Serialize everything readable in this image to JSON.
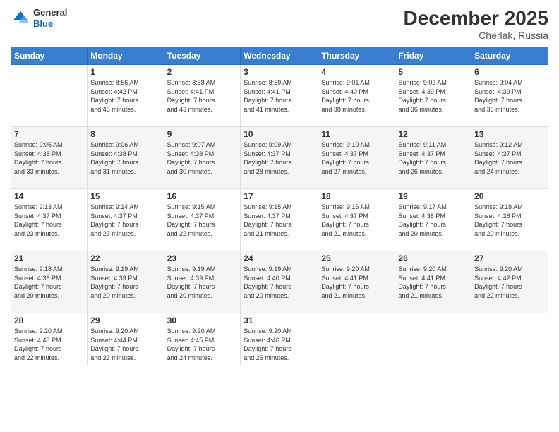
{
  "header": {
    "logo": {
      "general": "General",
      "blue": "Blue"
    },
    "title": "December 2025",
    "location": "Cherlak, Russia"
  },
  "days_of_week": [
    "Sunday",
    "Monday",
    "Tuesday",
    "Wednesday",
    "Thursday",
    "Friday",
    "Saturday"
  ],
  "weeks": [
    [
      {
        "day": "",
        "info": ""
      },
      {
        "day": "1",
        "info": "Sunrise: 8:56 AM\nSunset: 4:42 PM\nDaylight: 7 hours\nand 45 minutes."
      },
      {
        "day": "2",
        "info": "Sunrise: 8:58 AM\nSunset: 4:41 PM\nDaylight: 7 hours\nand 43 minutes."
      },
      {
        "day": "3",
        "info": "Sunrise: 8:59 AM\nSunset: 4:41 PM\nDaylight: 7 hours\nand 41 minutes."
      },
      {
        "day": "4",
        "info": "Sunrise: 9:01 AM\nSunset: 4:40 PM\nDaylight: 7 hours\nand 38 minutes."
      },
      {
        "day": "5",
        "info": "Sunrise: 9:02 AM\nSunset: 4:39 PM\nDaylight: 7 hours\nand 36 minutes."
      },
      {
        "day": "6",
        "info": "Sunrise: 9:04 AM\nSunset: 4:39 PM\nDaylight: 7 hours\nand 35 minutes."
      }
    ],
    [
      {
        "day": "7",
        "info": "Sunrise: 9:05 AM\nSunset: 4:38 PM\nDaylight: 7 hours\nand 33 minutes."
      },
      {
        "day": "8",
        "info": "Sunrise: 9:06 AM\nSunset: 4:38 PM\nDaylight: 7 hours\nand 31 minutes."
      },
      {
        "day": "9",
        "info": "Sunrise: 9:07 AM\nSunset: 4:38 PM\nDaylight: 7 hours\nand 30 minutes."
      },
      {
        "day": "10",
        "info": "Sunrise: 9:09 AM\nSunset: 4:37 PM\nDaylight: 7 hours\nand 28 minutes."
      },
      {
        "day": "11",
        "info": "Sunrise: 9:10 AM\nSunset: 4:37 PM\nDaylight: 7 hours\nand 27 minutes."
      },
      {
        "day": "12",
        "info": "Sunrise: 9:11 AM\nSunset: 4:37 PM\nDaylight: 7 hours\nand 26 minutes."
      },
      {
        "day": "13",
        "info": "Sunrise: 9:12 AM\nSunset: 4:37 PM\nDaylight: 7 hours\nand 24 minutes."
      }
    ],
    [
      {
        "day": "14",
        "info": "Sunrise: 9:13 AM\nSunset: 4:37 PM\nDaylight: 7 hours\nand 23 minutes."
      },
      {
        "day": "15",
        "info": "Sunrise: 9:14 AM\nSunset: 4:37 PM\nDaylight: 7 hours\nand 23 minutes."
      },
      {
        "day": "16",
        "info": "Sunrise: 9:15 AM\nSunset: 4:37 PM\nDaylight: 7 hours\nand 22 minutes."
      },
      {
        "day": "17",
        "info": "Sunrise: 9:15 AM\nSunset: 4:37 PM\nDaylight: 7 hours\nand 21 minutes."
      },
      {
        "day": "18",
        "info": "Sunrise: 9:16 AM\nSunset: 4:37 PM\nDaylight: 7 hours\nand 21 minutes."
      },
      {
        "day": "19",
        "info": "Sunrise: 9:17 AM\nSunset: 4:38 PM\nDaylight: 7 hours\nand 20 minutes."
      },
      {
        "day": "20",
        "info": "Sunrise: 9:18 AM\nSunset: 4:38 PM\nDaylight: 7 hours\nand 20 minutes."
      }
    ],
    [
      {
        "day": "21",
        "info": "Sunrise: 9:18 AM\nSunset: 4:38 PM\nDaylight: 7 hours\nand 20 minutes."
      },
      {
        "day": "22",
        "info": "Sunrise: 9:19 AM\nSunset: 4:39 PM\nDaylight: 7 hours\nand 20 minutes."
      },
      {
        "day": "23",
        "info": "Sunrise: 9:19 AM\nSunset: 4:39 PM\nDaylight: 7 hours\nand 20 minutes."
      },
      {
        "day": "24",
        "info": "Sunrise: 9:19 AM\nSunset: 4:40 PM\nDaylight: 7 hours\nand 20 minutes."
      },
      {
        "day": "25",
        "info": "Sunrise: 9:20 AM\nSunset: 4:41 PM\nDaylight: 7 hours\nand 21 minutes."
      },
      {
        "day": "26",
        "info": "Sunrise: 9:20 AM\nSunset: 4:41 PM\nDaylight: 7 hours\nand 21 minutes."
      },
      {
        "day": "27",
        "info": "Sunrise: 9:20 AM\nSunset: 4:42 PM\nDaylight: 7 hours\nand 22 minutes."
      }
    ],
    [
      {
        "day": "28",
        "info": "Sunrise: 9:20 AM\nSunset: 4:43 PM\nDaylight: 7 hours\nand 22 minutes."
      },
      {
        "day": "29",
        "info": "Sunrise: 9:20 AM\nSunset: 4:44 PM\nDaylight: 7 hours\nand 23 minutes."
      },
      {
        "day": "30",
        "info": "Sunrise: 9:20 AM\nSunset: 4:45 PM\nDaylight: 7 hours\nand 24 minutes."
      },
      {
        "day": "31",
        "info": "Sunrise: 9:20 AM\nSunset: 4:46 PM\nDaylight: 7 hours\nand 25 minutes."
      },
      {
        "day": "",
        "info": ""
      },
      {
        "day": "",
        "info": ""
      },
      {
        "day": "",
        "info": ""
      }
    ]
  ]
}
